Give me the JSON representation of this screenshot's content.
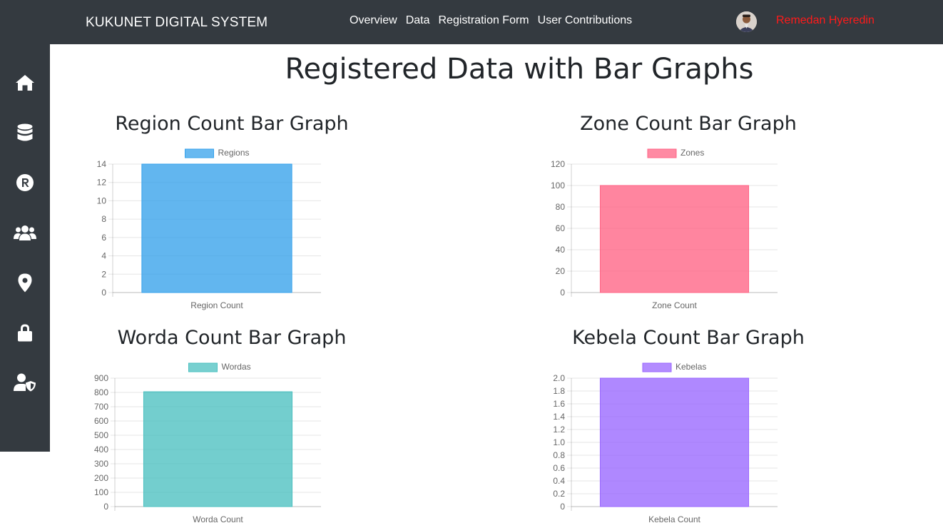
{
  "header": {
    "brand": "KUKUNET DIGITAL SYSTEM",
    "nav": [
      "Overview",
      "Data",
      "Registration Form",
      "User Contributions"
    ],
    "user_name": "Remedan Hyeredin"
  },
  "sidebar": {
    "icons": [
      "home-icon",
      "database-icon",
      "registered-icon",
      "users-icon",
      "map-pin-icon",
      "lock-icon",
      "user-shield-icon"
    ]
  },
  "page": {
    "title": "Registered Data with Bar Graphs"
  },
  "chart_data": [
    {
      "type": "bar",
      "title": "Region Count Bar Graph",
      "categories": [
        "Region Count"
      ],
      "series": [
        {
          "name": "Regions",
          "values": [
            14
          ]
        }
      ],
      "ylim": [
        0,
        14
      ],
      "yticks": [
        "0",
        "2",
        "4",
        "6",
        "8",
        "10",
        "12",
        "14"
      ],
      "color": "#36a2eb"
    },
    {
      "type": "bar",
      "title": "Zone Count Bar Graph",
      "categories": [
        "Zone Count"
      ],
      "series": [
        {
          "name": "Zones",
          "values": [
            100
          ]
        }
      ],
      "ylim": [
        0,
        120
      ],
      "yticks": [
        "0",
        "20",
        "40",
        "60",
        "80",
        "100",
        "120"
      ],
      "color": "#ff6384"
    },
    {
      "type": "bar",
      "title": "Worda Count Bar Graph",
      "categories": [
        "Worda Count"
      ],
      "series": [
        {
          "name": "Wordas",
          "values": [
            805
          ]
        }
      ],
      "ylim": [
        0,
        900
      ],
      "yticks": [
        "0",
        "100",
        "200",
        "300",
        "400",
        "500",
        "600",
        "700",
        "800",
        "900"
      ],
      "color": "#4bc0c0"
    },
    {
      "type": "bar",
      "title": "Kebela Count Bar Graph",
      "categories": [
        "Kebela Count"
      ],
      "series": [
        {
          "name": "Kebelas",
          "values": [
            2
          ]
        }
      ],
      "ylim": [
        0,
        2
      ],
      "yticks": [
        "0",
        "0.2",
        "0.4",
        "0.6",
        "0.8",
        "1.0",
        "1.2",
        "1.4",
        "1.6",
        "1.8",
        "2.0"
      ],
      "color": "#9966ff"
    }
  ]
}
